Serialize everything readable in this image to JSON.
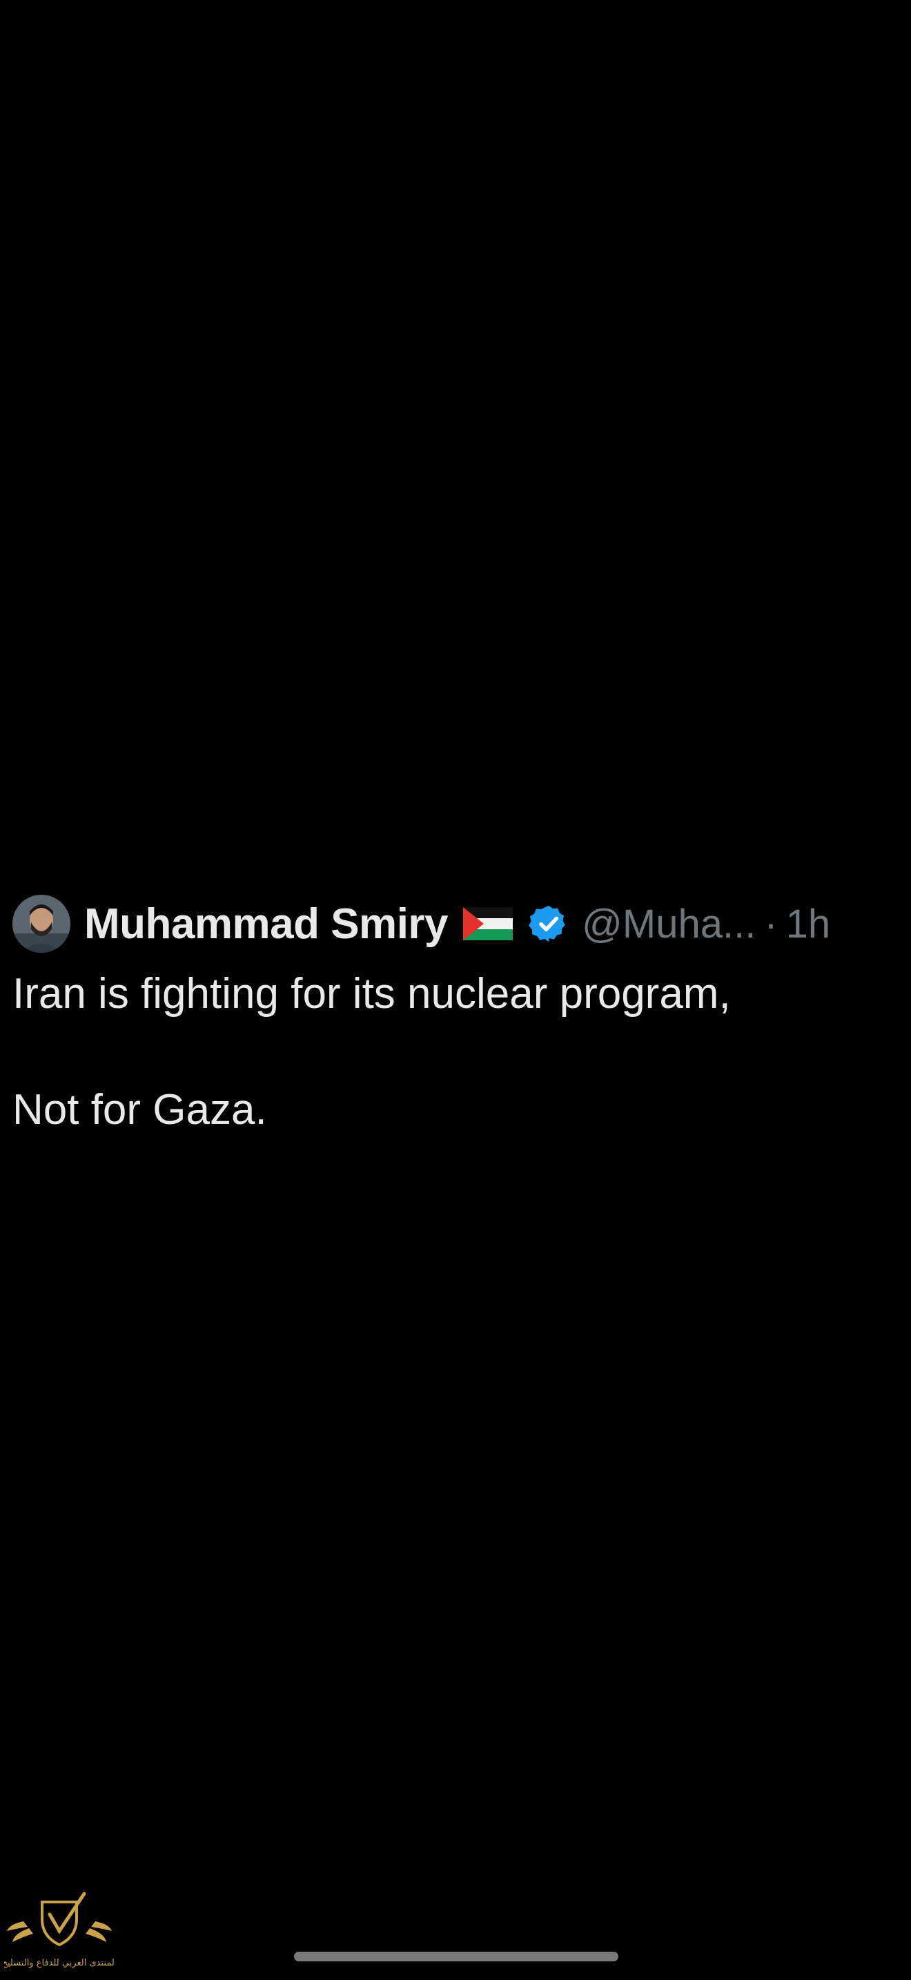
{
  "tweet": {
    "author": {
      "display_name": "Muhammad Smiry",
      "flag_emoji": "palestine-flag-emoji",
      "verified_badge": "verified-icon",
      "handle": "@Muha...",
      "separator": "·",
      "time": "1h"
    },
    "text_lines": [
      "Iran is fighting for its nuclear program,",
      "",
      "Not for Gaza."
    ]
  },
  "watermark": {
    "icon": "forum-logo-watermark",
    "text": "المنتدى العربي للدفاع والتسليح"
  },
  "colors": {
    "background": "#000000",
    "primary_text": "#e7e9ea",
    "secondary_text": "#71767b",
    "verified_blue": "#1d9bf0"
  }
}
